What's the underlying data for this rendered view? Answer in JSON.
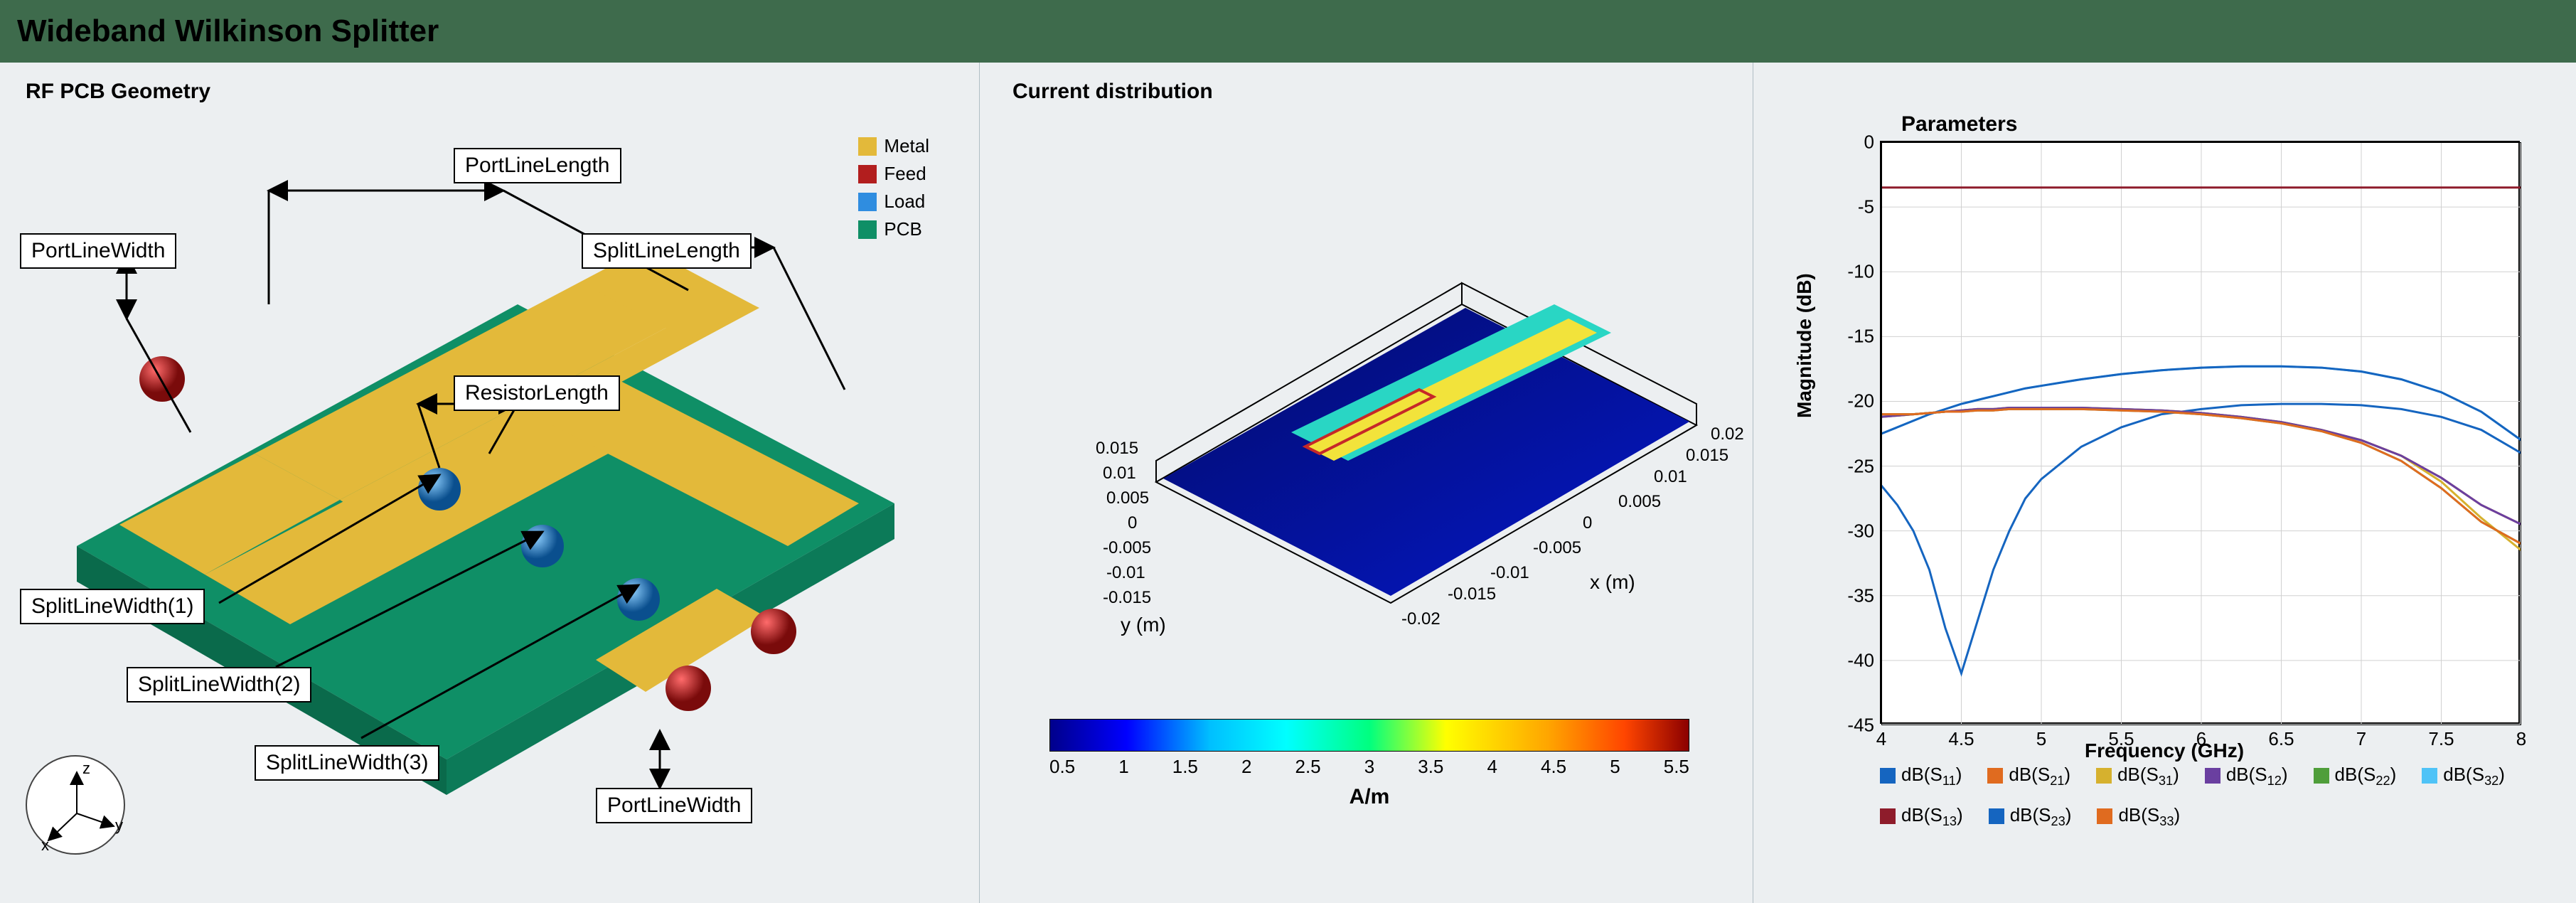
{
  "title": "Wideband Wilkinson Splitter",
  "panel1": {
    "title": "RF PCB Geometry",
    "labels": {
      "PortLineWidth": "PortLineWidth",
      "PortLineLength": "PortLineLength",
      "SplitLineLength": "SplitLineLength",
      "ResistorLength": "ResistorLength",
      "SplitLineWidth1": "SplitLineWidth(1)",
      "SplitLineWidth2": "SplitLineWidth(2)",
      "SplitLineWidth3": "SplitLineWidth(3)",
      "PortLineWidth2": "PortLineWidth"
    },
    "legend": [
      {
        "label": "Metal",
        "color": "#e3b93a"
      },
      {
        "label": "Feed",
        "color": "#b21e1e"
      },
      {
        "label": "Load",
        "color": "#2f8de0"
      },
      {
        "label": "PCB",
        "color": "#0f8f66"
      }
    ],
    "axes": {
      "x": "x",
      "y": "y",
      "z": "z"
    }
  },
  "panel2": {
    "title": "Current distribution",
    "xlabel": "x (m)",
    "ylabel": "y (m)",
    "xticks": [
      "-0.02",
      "-0.015",
      "-0.01",
      "-0.005",
      "0",
      "0.005",
      "0.01",
      "0.015",
      "0.02"
    ],
    "yticks": [
      "-0.015",
      "-0.01",
      "-0.005",
      "0",
      "0.005",
      "0.01",
      "0.015"
    ],
    "colorbar": {
      "ticks": [
        "0.5",
        "1",
        "1.5",
        "2",
        "2.5",
        "3",
        "3.5",
        "4",
        "4.5",
        "5",
        "5.5"
      ],
      "label": "A/m"
    }
  },
  "panel3": {
    "title": "Parameters",
    "xlabel": "Frequency (GHz)",
    "ylabel": "Magnitude (dB)",
    "xlim": [
      4,
      8
    ],
    "ylim": [
      -45,
      0
    ],
    "xticks": [
      4,
      4.5,
      5,
      5.5,
      6,
      6.5,
      7,
      7.5,
      8
    ],
    "yticks": [
      0,
      -5,
      -10,
      -15,
      -20,
      -25,
      -30,
      -35,
      -40,
      -45
    ],
    "legend": [
      {
        "name": "dB(S",
        "sub": "11",
        "close": ")",
        "color": "#1565c0"
      },
      {
        "name": "dB(S",
        "sub": "21",
        "close": ")",
        "color": "#e06b1f"
      },
      {
        "name": "dB(S",
        "sub": "31",
        "close": ")",
        "color": "#d6b12e"
      },
      {
        "name": "dB(S",
        "sub": "12",
        "close": ")",
        "color": "#6a3fa0"
      },
      {
        "name": "dB(S",
        "sub": "22",
        "close": ")",
        "color": "#4f9e3a"
      },
      {
        "name": "dB(S",
        "sub": "32",
        "close": ")",
        "color": "#4fc3f7"
      },
      {
        "name": "dB(S",
        "sub": "13",
        "close": ")",
        "color": "#8e1c2b"
      },
      {
        "name": "dB(S",
        "sub": "23",
        "close": ")",
        "color": "#1565c0"
      },
      {
        "name": "dB(S",
        "sub": "33",
        "close": ")",
        "color": "#e06b1f"
      }
    ]
  },
  "chart_data": {
    "type": "line",
    "title": "Parameters",
    "xlabel": "Frequency (GHz)",
    "ylabel": "Magnitude (dB)",
    "xlim": [
      4,
      8
    ],
    "ylim": [
      -45,
      0
    ],
    "x": [
      4.0,
      4.1,
      4.2,
      4.3,
      4.4,
      4.5,
      4.6,
      4.7,
      4.8,
      4.9,
      5.0,
      5.25,
      5.5,
      5.75,
      6.0,
      6.25,
      6.5,
      6.75,
      7.0,
      7.25,
      7.5,
      7.75,
      8.0
    ],
    "series": [
      {
        "name": "dB(S11)",
        "color": "#1565c0",
        "values": [
          -26.5,
          -28.0,
          -30.0,
          -33.0,
          -37.5,
          -41.0,
          -37.0,
          -33.0,
          -30.0,
          -27.5,
          -26.0,
          -23.5,
          -22.0,
          -21.0,
          -20.6,
          -20.3,
          -20.2,
          -20.2,
          -20.3,
          -20.6,
          -21.2,
          -22.2,
          -24.0
        ]
      },
      {
        "name": "dB(S21)",
        "color": "#e06b1f",
        "values": [
          -21.2,
          -21.1,
          -21.0,
          -20.9,
          -20.8,
          -20.7,
          -20.6,
          -20.6,
          -20.5,
          -20.5,
          -20.5,
          -20.5,
          -20.6,
          -20.7,
          -20.9,
          -21.2,
          -21.6,
          -22.2,
          -23.0,
          -24.2,
          -25.9,
          -28.0,
          -29.5
        ]
      },
      {
        "name": "dB(S31)",
        "color": "#d6b12e",
        "values": [
          -21.2,
          -21.1,
          -21.0,
          -20.9,
          -20.8,
          -20.7,
          -20.6,
          -20.6,
          -20.5,
          -20.5,
          -20.5,
          -20.5,
          -20.6,
          -20.7,
          -20.9,
          -21.2,
          -21.6,
          -22.2,
          -23.0,
          -24.2,
          -26.2,
          -29.0,
          -31.5
        ]
      },
      {
        "name": "dB(S12)",
        "color": "#6a3fa0",
        "values": [
          -21.2,
          -21.1,
          -21.0,
          -20.9,
          -20.8,
          -20.7,
          -20.6,
          -20.6,
          -20.5,
          -20.5,
          -20.5,
          -20.5,
          -20.6,
          -20.7,
          -20.9,
          -21.2,
          -21.6,
          -22.2,
          -23.0,
          -24.2,
          -25.9,
          -28.0,
          -29.5
        ]
      },
      {
        "name": "dB(S22)",
        "color": "#4f9e3a",
        "values": [
          -21.0,
          -21.0,
          -21.0,
          -20.9,
          -20.8,
          -20.8,
          -20.7,
          -20.7,
          -20.6,
          -20.6,
          -20.6,
          -20.6,
          -20.7,
          -20.8,
          -21.0,
          -21.3,
          -21.7,
          -22.3,
          -23.2,
          -24.6,
          -26.7,
          -29.3,
          -31.0
        ]
      },
      {
        "name": "dB(S32)",
        "color": "#4fc3f7",
        "values": [
          -22.5,
          -22.0,
          -21.5,
          -21.0,
          -20.6,
          -20.2,
          -19.9,
          -19.6,
          -19.3,
          -19.0,
          -18.8,
          -18.3,
          -17.9,
          -17.6,
          -17.4,
          -17.3,
          -17.3,
          -17.4,
          -17.7,
          -18.3,
          -19.3,
          -20.8,
          -23.0
        ]
      },
      {
        "name": "dB(S13)",
        "color": "#8e1c2b",
        "values": [
          -3.5,
          -3.5,
          -3.5,
          -3.5,
          -3.5,
          -3.5,
          -3.5,
          -3.5,
          -3.5,
          -3.5,
          -3.5,
          -3.5,
          -3.5,
          -3.5,
          -3.5,
          -3.5,
          -3.5,
          -3.5,
          -3.5,
          -3.5,
          -3.5,
          -3.5,
          -3.5
        ]
      },
      {
        "name": "dB(S23)",
        "color": "#1565c0",
        "values": [
          -22.5,
          -22.0,
          -21.5,
          -21.0,
          -20.6,
          -20.2,
          -19.9,
          -19.6,
          -19.3,
          -19.0,
          -18.8,
          -18.3,
          -17.9,
          -17.6,
          -17.4,
          -17.3,
          -17.3,
          -17.4,
          -17.7,
          -18.3,
          -19.3,
          -20.8,
          -23.0
        ]
      },
      {
        "name": "dB(S33)",
        "color": "#e06b1f",
        "values": [
          -21.0,
          -21.0,
          -21.0,
          -20.9,
          -20.8,
          -20.8,
          -20.7,
          -20.7,
          -20.6,
          -20.6,
          -20.6,
          -20.6,
          -20.7,
          -20.8,
          -21.0,
          -21.3,
          -21.7,
          -22.3,
          -23.2,
          -24.6,
          -26.7,
          -29.3,
          -31.0
        ]
      }
    ]
  }
}
